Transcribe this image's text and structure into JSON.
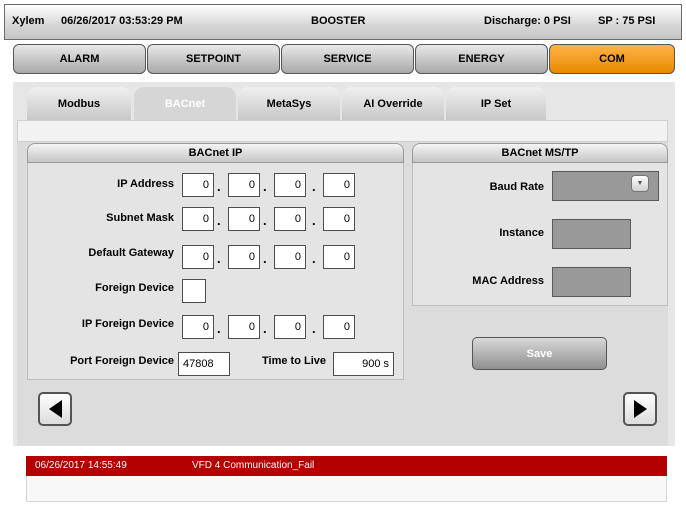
{
  "header": {
    "brand": "Xylem",
    "datetime": "06/26/2017 03:53:29 PM",
    "mode": "BOOSTER",
    "discharge": "Discharge: 0 PSI",
    "setpoint": "SP : 75 PSI"
  },
  "nav": {
    "items": [
      "ALARM",
      "SETPOINT",
      "SERVICE",
      "ENERGY",
      "COM"
    ],
    "active": "COM",
    "active_color": "#f39a1e"
  },
  "subtabs": {
    "items": [
      "Modbus",
      "BACnet",
      "MetaSys",
      "AI Override",
      "IP Set"
    ],
    "active": "BACnet"
  },
  "bacnet_ip": {
    "title": "BACnet IP",
    "ip_address": {
      "label": "IP Address",
      "octets": [
        "0",
        "0",
        "0",
        "0"
      ]
    },
    "subnet_mask": {
      "label": "Subnet Mask",
      "octets": [
        "0",
        "0",
        "0",
        "0"
      ]
    },
    "default_gateway": {
      "label": "Default Gateway",
      "octets": [
        "0",
        "0",
        "0",
        "0"
      ]
    },
    "foreign_device": {
      "label": "Foreign Device",
      "checked": false
    },
    "ip_foreign_device": {
      "label": "IP Foreign Device",
      "octets": [
        "0",
        "0",
        "0",
        "0"
      ]
    },
    "port_foreign_device": {
      "label": "Port Foreign Device",
      "value": "47808"
    },
    "time_to_live": {
      "label": "Time to Live",
      "value": "900 s"
    },
    "separator": "."
  },
  "bacnet_mstp": {
    "title": "BACnet MS/TP",
    "baud_rate": {
      "label": "Baud Rate",
      "value": ""
    },
    "instance": {
      "label": "Instance",
      "value": ""
    },
    "mac_address": {
      "label": "MAC Address",
      "value": ""
    },
    "save_label": "Save"
  },
  "navigation": {
    "prev_icon": "left-triangle-icon",
    "next_icon": "right-triangle-icon"
  },
  "alarm": {
    "timestamp": "06/26/2017 14:55:49",
    "message": "VFD 4 Communication_Fail",
    "color": "#b30000"
  }
}
